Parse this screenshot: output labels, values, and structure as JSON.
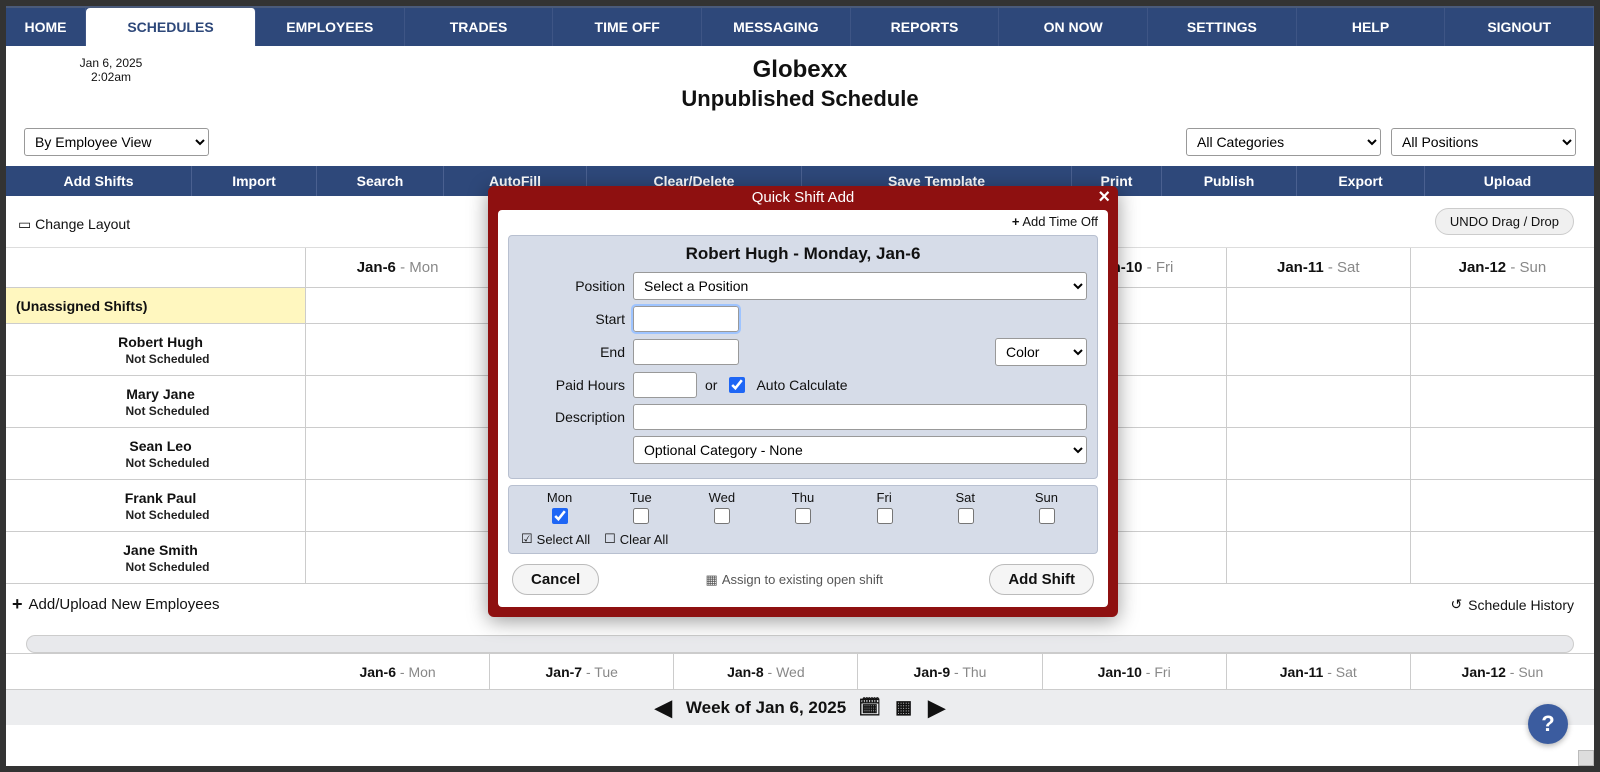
{
  "nav": {
    "items": [
      "HOME",
      "SCHEDULES",
      "EMPLOYEES",
      "TRADES",
      "TIME OFF",
      "MESSAGING",
      "REPORTS",
      "ON NOW",
      "SETTINGS",
      "HELP",
      "SIGNOUT"
    ],
    "active_index": 1
  },
  "header": {
    "date": "Jan 6, 2025",
    "time": "2:02am",
    "company": "Globexx",
    "subtitle": "Unpublished Schedule"
  },
  "filter": {
    "view_selected": "By Employee View",
    "category_selected": "All Categories",
    "position_selected": "All Positions"
  },
  "actions": [
    "Add Shifts",
    "Import",
    "Search",
    "AutoFill",
    "Clear/Delete",
    "Save Template",
    "Print",
    "Publish",
    "Export",
    "Upload"
  ],
  "layout_row": {
    "change_layout": "Change Layout",
    "undo": "UNDO Drag / Drop"
  },
  "days": [
    {
      "bold": "Jan-6",
      "weak": " - Mon"
    },
    {
      "bold": "Jan-7",
      "weak": " - Tue"
    },
    {
      "bold": "Jan-8",
      "weak": " - Wed"
    },
    {
      "bold": "Jan-9",
      "weak": " - Thu"
    },
    {
      "bold": "Jan-10",
      "weak": " - Fri"
    },
    {
      "bold": "Jan-11",
      "weak": " - Sat"
    },
    {
      "bold": "Jan-12",
      "weak": " - Sun"
    }
  ],
  "unassigned_label": "(Unassigned Shifts)",
  "employees": [
    {
      "name": "Robert Hugh",
      "sub": "Not Scheduled"
    },
    {
      "name": "Mary Jane",
      "sub": "Not Scheduled"
    },
    {
      "name": "Sean Leo",
      "sub": "Not Scheduled"
    },
    {
      "name": "Frank Paul",
      "sub": "Not Scheduled"
    },
    {
      "name": "Jane Smith",
      "sub": "Not Scheduled"
    }
  ],
  "add_employees": "Add/Upload New Employees",
  "schedule_history": "Schedule History",
  "week_label": "Week of Jan 6, 2025",
  "modal": {
    "title": "Quick Shift Add",
    "add_time_off": "Add Time Off",
    "form_title": "Robert Hugh - Monday, Jan-6",
    "labels": {
      "position": "Position",
      "start": "Start",
      "end": "End",
      "paid_hours": "Paid Hours",
      "description": "Description",
      "or": "or",
      "auto_calc": "Auto Calculate"
    },
    "position_placeholder": "Select a Position",
    "color_placeholder": "Color",
    "category_placeholder": "Optional Category - None",
    "days": [
      "Mon",
      "Tue",
      "Wed",
      "Thu",
      "Fri",
      "Sat",
      "Sun"
    ],
    "days_checked": [
      true,
      false,
      false,
      false,
      false,
      false,
      false
    ],
    "select_all": "Select All",
    "clear_all": "Clear All",
    "cancel": "Cancel",
    "assign_link": "Assign to existing open shift",
    "add_shift": "Add Shift"
  }
}
